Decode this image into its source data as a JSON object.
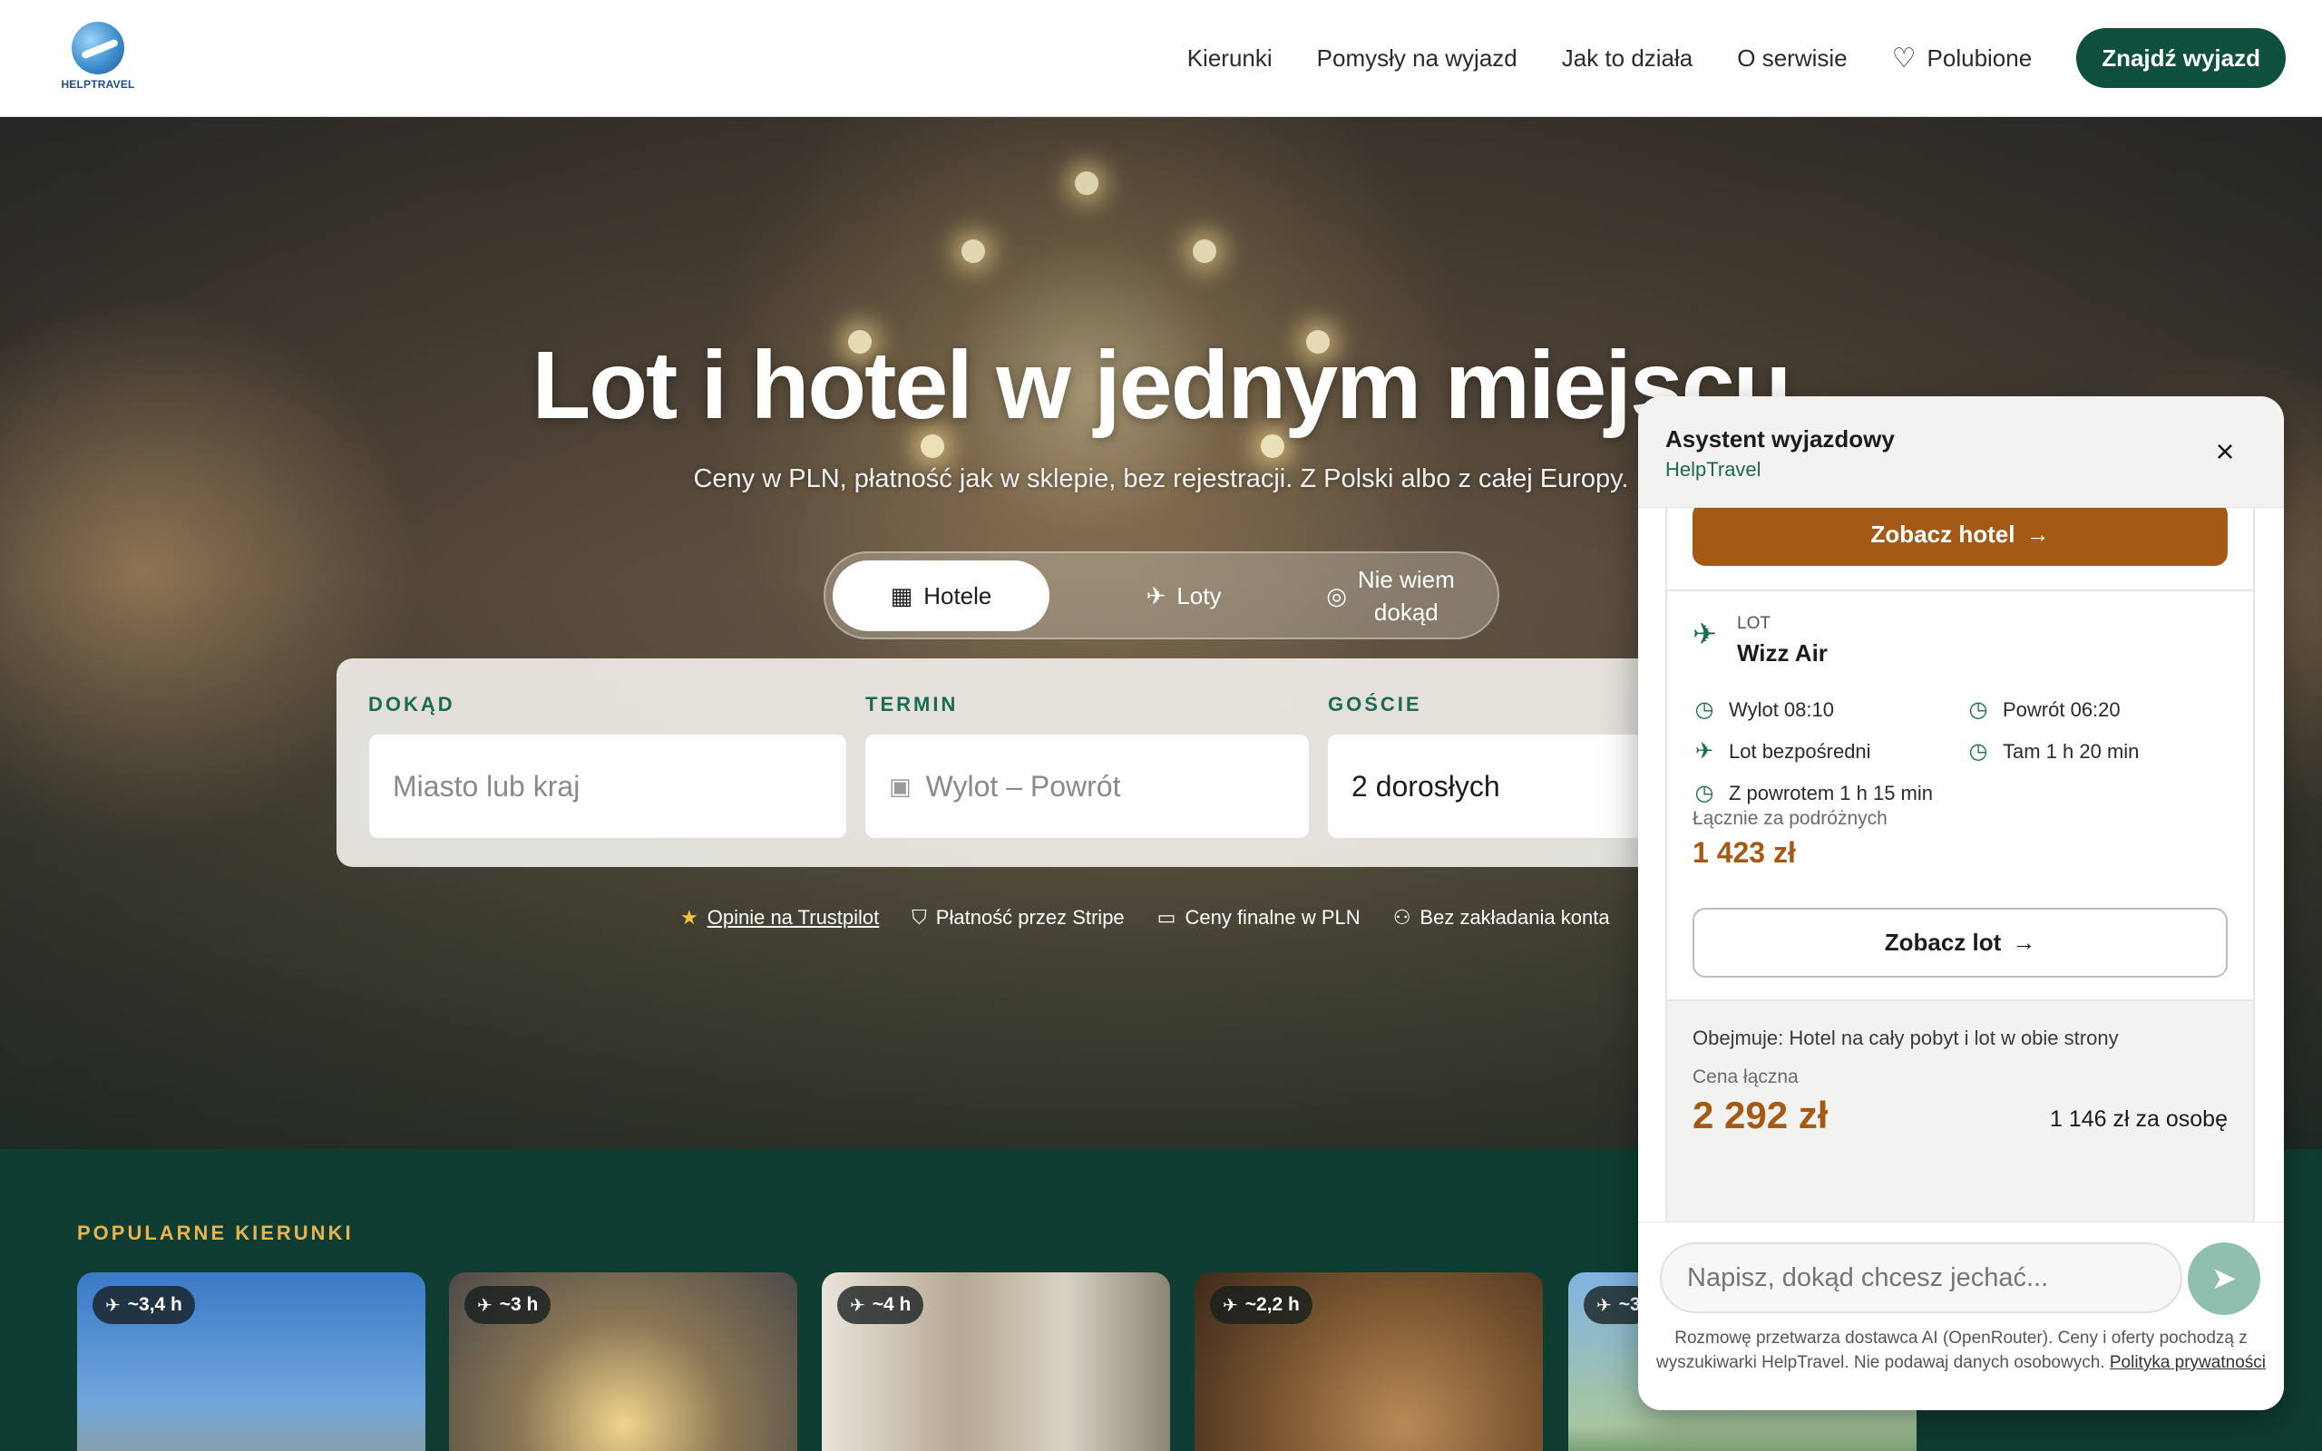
{
  "header": {
    "logo_text": "HELPTRAVEL",
    "nav": [
      "Kierunki",
      "Pomysły na wyjazd",
      "Jak to działa",
      "O serwisie"
    ],
    "favorites": "Polubione",
    "cta": "Znajdź wyjazd"
  },
  "hero": {
    "title": "Lot i hotel w jednym miejscu",
    "subtitle": "Ceny w PLN, płatność jak w sklepie, bez rejestracji. Z Polski albo z całej Europy.",
    "tabs": {
      "hotels": "Hotele",
      "flights": "Loty",
      "unsure_line1": "Nie wiem",
      "unsure_line2": "dokąd"
    },
    "search": {
      "destination_label": "DOKĄD",
      "destination_placeholder": "Miasto lub kraj",
      "dates_label": "TERMIN",
      "dates_placeholder": "Wylot – Powrót",
      "guests_label": "GOŚCIE",
      "guests_value": "2 dorosłych"
    },
    "trust": {
      "trustpilot": "Opinie na Trustpilot",
      "stripe": "Płatność przez Stripe",
      "pln": "Ceny finalne w PLN",
      "no_account": "Bez zakładania konta"
    }
  },
  "popular": {
    "title": "POPULARNE KIERUNKI",
    "cards": [
      {
        "duration": "~3,4 h"
      },
      {
        "duration": "~3 h"
      },
      {
        "duration": "~4 h"
      },
      {
        "duration": "~2,2 h"
      },
      {
        "duration": "~3"
      }
    ]
  },
  "chat": {
    "title": "Asystent wyjazdowy",
    "brand": "HelpTravel",
    "hotel_button": "Zobacz hotel",
    "flight": {
      "kind": "LOT",
      "airline": "Wizz Air",
      "departure": "Wylot 08:10",
      "return": "Powrót 06:20",
      "direct": "Lot bezpośredni",
      "outbound_duration": "Tam 1 h 20 min",
      "return_duration": "Z powrotem 1 h 15 min",
      "total_label": "Łącznie za podróżnych",
      "total_value": "1 423 zł",
      "button": "Zobacz lot"
    },
    "summary": {
      "includes": "Obejmuje: Hotel na cały pobyt i lot w obie strony",
      "price_label": "Cena łączna",
      "price_value": "2 292 zł",
      "per_person": "1 146 zł za osobę"
    },
    "input_placeholder": "Napisz, dokąd chcesz jechać...",
    "disclaimer": "Rozmowę przetwarza dostawca AI (OpenRouter). Ceny i oferty pochodzą z wyszukiwarki HelpTravel. Nie podawaj danych osobowych.",
    "privacy_link": "Polityka prywatności"
  },
  "icons": {
    "heart": "heart-icon",
    "hotel": "building-icon",
    "plane": "plane-icon",
    "compass": "compass-icon",
    "calendar": "calendar-icon",
    "star": "star-icon",
    "shield": "shield-icon",
    "wallet": "wallet-icon",
    "user": "user-x-icon",
    "clock": "clock-icon",
    "send": "send-icon",
    "close": "close-icon",
    "arrow": "arrow-right-icon"
  },
  "colors": {
    "brand_green": "#0f4f3e",
    "accent_orange": "#a45a14",
    "label_green": "#1b6a52",
    "section_gold": "#e7b450"
  }
}
